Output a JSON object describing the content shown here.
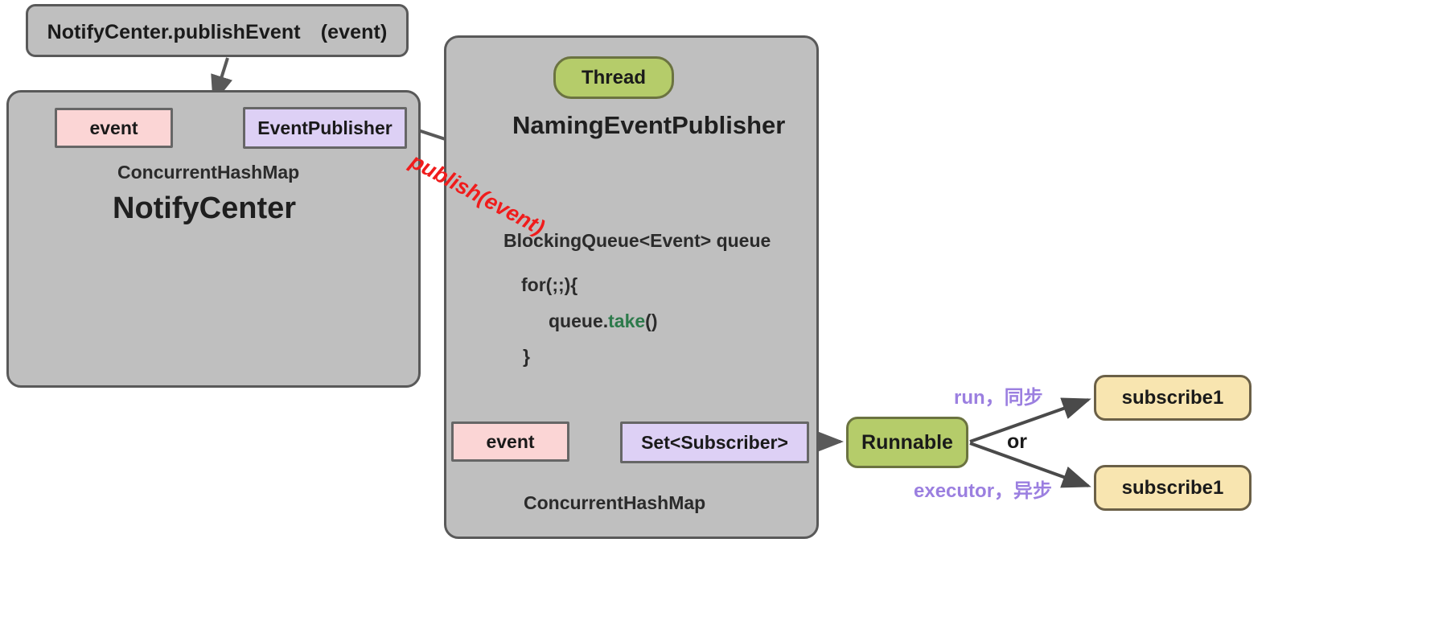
{
  "diagram": {
    "title": "NotifyCenter / NamingEventPublisher event flow",
    "colors": {
      "panel_fill": "#bfbfbf",
      "panel_stroke": "#595959",
      "pink": "#fbd5d5",
      "purple": "#ddd0f5",
      "green": "#b5cc6a",
      "yellow": "#f8e5b0",
      "arrow": "#595959",
      "publish_label": "#f01c1c",
      "annotation_violet": "#9b7fe0",
      "keyword_green": "#2d7a4b"
    }
  },
  "top": {
    "publish_event_call": "NotifyCenter.publishEvent　(event)"
  },
  "notify_center_panel": {
    "event_box": "event",
    "event_publisher_box": "EventPublisher",
    "map_type": "ConcurrentHashMap",
    "title": "NotifyCenter"
  },
  "naming_event_publisher_panel": {
    "thread_pill": "Thread",
    "title": "NamingEventPublisher",
    "queue_field": "BlockingQueue<Event> queue",
    "code": {
      "for_line": "for(;;){",
      "take_prefix": "queue.",
      "take_keyword": "take",
      "take_suffix": "()",
      "close_brace": "}"
    },
    "event_box": "event",
    "subscriber_set_box": "Set<Subscriber>",
    "map_type": "ConcurrentHashMap"
  },
  "dispatch": {
    "runnable_box": "Runnable",
    "or_label": "or",
    "sync_label": "run，同步",
    "async_label": "executor，异步",
    "sync_target": "subscribe1",
    "async_target": "subscribe1"
  },
  "edges": {
    "publish_event_label": "publish(event)"
  }
}
